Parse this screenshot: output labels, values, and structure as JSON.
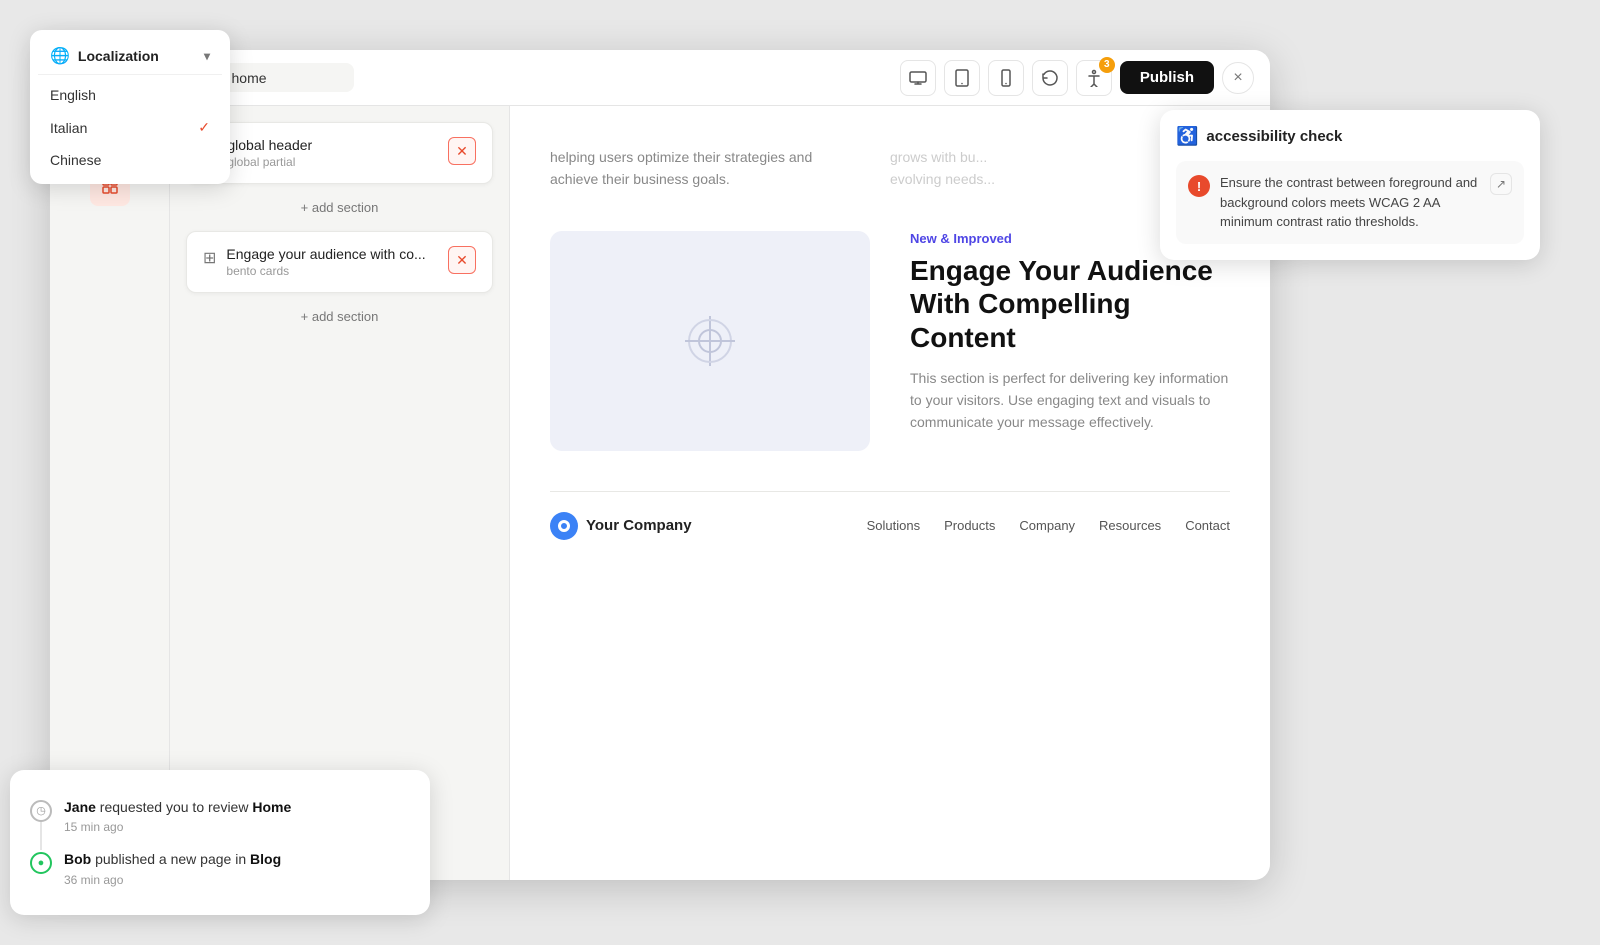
{
  "localization": {
    "label": "Localization",
    "languages": [
      {
        "name": "English",
        "active": false
      },
      {
        "name": "Italian",
        "active": true
      },
      {
        "name": "Chinese",
        "active": false
      }
    ]
  },
  "toolbar": {
    "url": "/ home",
    "publish_label": "Publish",
    "close_label": "×",
    "badge_count": "3"
  },
  "sections": [
    {
      "id": "global-header",
      "icon": "☰",
      "title": "global header",
      "subtitle": "global partial"
    },
    {
      "id": "bento",
      "icon": "⊞",
      "title": "Engage your audience with co...",
      "subtitle": "bento cards"
    }
  ],
  "add_section_label": "+ add section",
  "canvas": {
    "preview_text": "helping users optimize their strategies and achieve their business goals.",
    "preview_text2": "grows with bu... evolving needs...",
    "bento": {
      "tag": "New & Improved",
      "heading": "Engage Your Audience With Compelling Content",
      "description": "This section is perfect for delivering key information to your visitors. Use engaging text and visuals to communicate your message effectively."
    },
    "footer": {
      "company": "Your Company",
      "nav_items": [
        "Solutions",
        "Products",
        "Company",
        "Resources",
        "Contact"
      ]
    }
  },
  "accessibility": {
    "title": "accessibility check",
    "issue": "Ensure the contrast between foreground and background colors meets WCAG 2 AA minimum contrast ratio thresholds."
  },
  "activity": {
    "items": [
      {
        "user": "Jane",
        "action": "requested you to review",
        "target": "Home",
        "time": "15 min ago",
        "status": "pending"
      },
      {
        "user": "Bob",
        "action": "published a new page in",
        "target": "Blog",
        "time": "36 min ago",
        "status": "published"
      }
    ]
  }
}
